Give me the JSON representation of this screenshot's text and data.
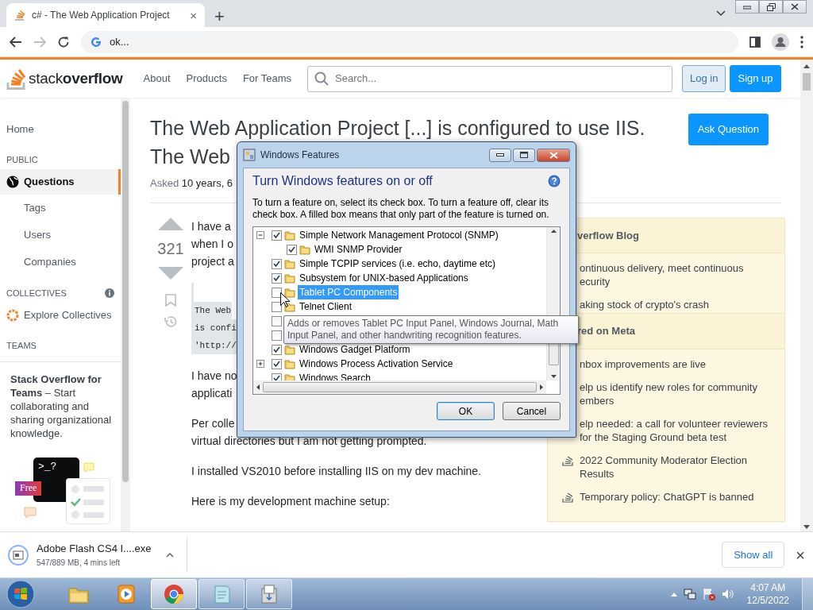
{
  "browser": {
    "tab": {
      "title": "c# - The Web Application Project",
      "close": "×"
    },
    "new_tab": "+",
    "address": "ok..."
  },
  "header": {
    "logo": "stack**overflow**",
    "nav": [
      "About",
      "Products",
      "For Teams"
    ],
    "search": {
      "placeholder": "Search..."
    },
    "buttons": [
      {
        "label": "Log in",
        "kind": "secondary"
      },
      {
        "label": "Sign up",
        "kind": "primary"
      }
    ]
  },
  "left_nav": [
    {
      "kind": "link",
      "label": "Home",
      "selected": false
    },
    {
      "kind": "heading",
      "label": "PUBLIC"
    },
    {
      "kind": "globe_link",
      "label": "Questions",
      "selected": true
    },
    {
      "kind": "sublink",
      "label": "Tags",
      "selected": false
    },
    {
      "kind": "sublink",
      "label": "Users",
      "selected": false
    },
    {
      "kind": "sublink",
      "label": "Companies",
      "selected": false
    },
    {
      "kind": "heading",
      "label": "COLLECTIVES",
      "info": true
    },
    {
      "kind": "collective_link",
      "label": "Explore Collectives",
      "selected": false
    },
    {
      "kind": "heading",
      "label": "TEAMS"
    }
  ],
  "teams_promo": {
    "text": "**Stack Overflow for Teams** – Start collaborating and sharing organizational knowledge.",
    "prompt": ">_?",
    "badge": "Free"
  },
  "question": {
    "title_lines": [
      "The Web Application Project [...] is configured to use IIS.",
      "The Web"
    ],
    "ask_button": "Ask Question",
    "asked_label": "Asked",
    "asked_value": "10 years, 6",
    "votes": "321",
    "body": [
      {
        "kind": "text",
        "lines": [
          "I have a",
          "when I o",
          "project a"
        ]
      },
      {
        "kind": "code",
        "lines": [
          "The Web",
          "is confi",
          "'http://"
        ]
      },
      {
        "kind": "text",
        "lines": [
          "I have no",
          "applicati"
        ]
      },
      {
        "kind": "text",
        "lines": [
          "Per colle",
          "virtual directories but I am not getting prompted."
        ]
      },
      {
        "kind": "text",
        "lines": [
          "I installed VS2010 before installing IIS on my dev machine."
        ]
      },
      {
        "kind": "text",
        "lines": [
          "Here is my development machine setup:"
        ]
      }
    ]
  },
  "sidebar": [
    {
      "title": "verflow Blog",
      "items": [
        {
          "lines": [
            "ontinuous delivery, meet continuous",
            "ecurity"
          ]
        },
        {
          "lines": [
            "aking stock of crypto's crash"
          ]
        }
      ]
    },
    {
      "title": "red on Meta",
      "items": [
        {
          "lines": [
            "nbox improvements are live"
          ]
        },
        {
          "lines": [
            "elp us identify new roles for community",
            "embers"
          ]
        },
        {
          "lines": [
            "elp needed: a call for volunteer reviewers",
            "for the Staging Ground beta test"
          ]
        },
        {
          "lines": [
            "2022 Community Moderator Election",
            "Results"
          ],
          "icon": true
        },
        {
          "lines": [
            "Temporary policy: ChatGPT is banned"
          ],
          "icon": true
        }
      ]
    }
  ],
  "dialog": {
    "title": "Windows Features",
    "heading": "Turn Windows features on or off",
    "description": "To turn a feature on, select its check box. To turn a feature off, clear its check box. A filled box means that only part of the feature is turned on.",
    "features": [
      {
        "name": "Simple Network Management Protocol (SNMP)",
        "checked": true,
        "selected": false,
        "expanded": true,
        "children": [
          {
            "name": "WMI SNMP Provider",
            "checked": true,
            "selected": false
          }
        ]
      },
      {
        "name": "Simple TCPIP services (i.e. echo, daytime etc)",
        "checked": true,
        "selected": false
      },
      {
        "name": "Subsystem for UNIX-based Applications",
        "checked": true,
        "selected": false
      },
      {
        "name": "Tablet PC Components",
        "checked": false,
        "selected": true
      },
      {
        "name": "Telnet Client",
        "checked": false,
        "selected": false
      },
      {
        "checked": false,
        "selected": false
      },
      {
        "checked": false,
        "selected": false
      },
      {
        "name": "Windows Gadget Platform",
        "checked": true,
        "selected": false
      },
      {
        "name": "Windows Process Activation Service",
        "checked": true,
        "selected": false,
        "expanded": false
      },
      {
        "name": "Windows Search",
        "checked": true,
        "selected": false
      }
    ],
    "tooltip": "Adds or removes Tablet PC Input Panel, Windows Journal, Math Input Panel, and other handwriting recognition features.",
    "buttons": [
      {
        "label": "OK",
        "kind": "default"
      },
      {
        "label": "Cancel",
        "kind": "normal"
      }
    ]
  },
  "download": {
    "file": "Adobe Flash CS4 I....exe",
    "status": "547/889 MB, 4 mins left",
    "show_all": "Show all",
    "close": "×"
  },
  "taskbar": {
    "apps": [
      {
        "kind": "folder",
        "open": false,
        "active": false
      },
      {
        "kind": "media",
        "open": false,
        "active": false
      },
      {
        "kind": "browser",
        "open": true,
        "active": true
      },
      {
        "kind": "notepad",
        "open": true,
        "active": false
      },
      {
        "kind": "installer",
        "open": true,
        "active": false
      }
    ],
    "time": "4:07 AM",
    "date": "12/5/2022"
  }
}
